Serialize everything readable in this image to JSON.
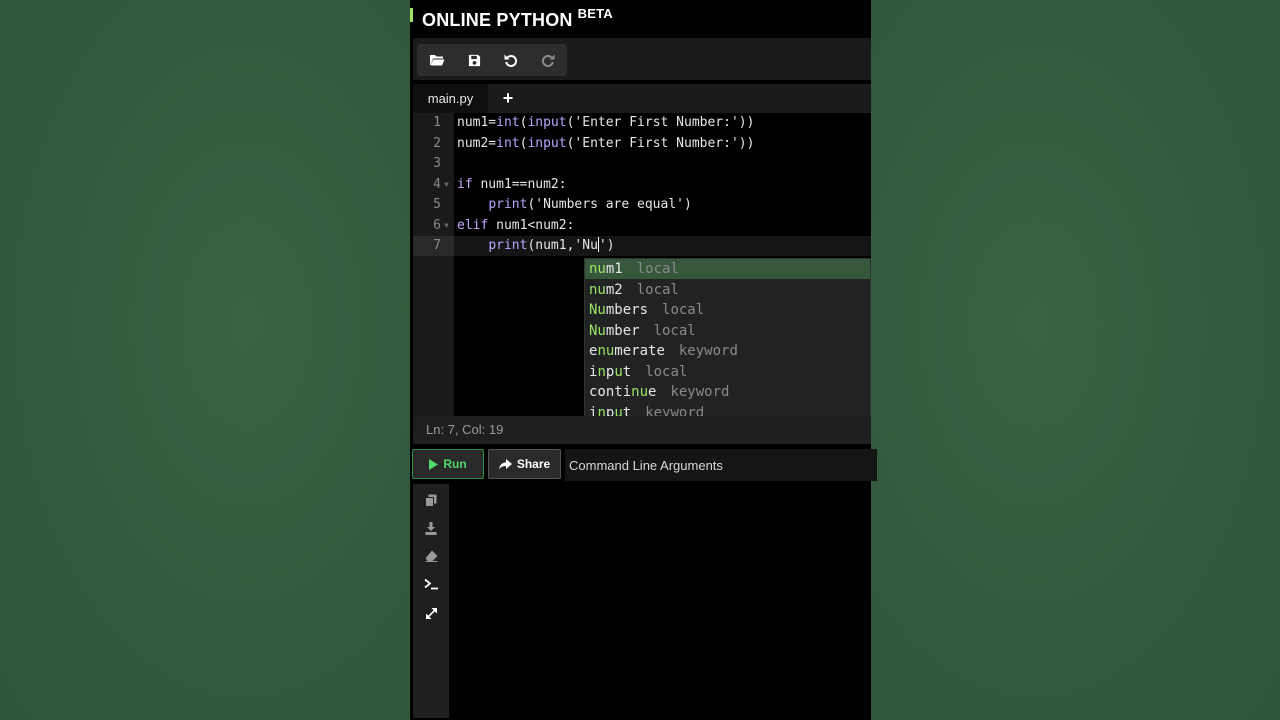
{
  "app": {
    "brand": "ONLINE PYTHON",
    "beta": "BETA"
  },
  "tabs": {
    "file": "main.py",
    "add": "+"
  },
  "editor": {
    "lines": [
      {
        "n": "1",
        "text": "num1=int(input('Enter First Number:'))"
      },
      {
        "n": "2",
        "text": "num2=int(input('Enter First Number:'))"
      },
      {
        "n": "3",
        "text": ""
      },
      {
        "n": "4",
        "text": "if num1==num2:"
      },
      {
        "n": "5",
        "text": "    print('Numbers are equal')"
      },
      {
        "n": "6",
        "text": "elif num1<num2:"
      },
      {
        "n": "7",
        "text": "    print(num1,'Nu')"
      }
    ]
  },
  "autocomplete": [
    {
      "label": "num1",
      "type": "local",
      "selected": true
    },
    {
      "label": "num2",
      "type": "local"
    },
    {
      "label": "Numbers",
      "type": "local"
    },
    {
      "label": "Number",
      "type": "local"
    },
    {
      "label": "enumerate",
      "type": "keyword"
    },
    {
      "label": "input",
      "type": "local"
    },
    {
      "label": "continue",
      "type": "keyword"
    },
    {
      "label": "input",
      "type": "keyword"
    }
  ],
  "status": {
    "position": "Ln: 7,  Col: 19"
  },
  "actions": {
    "run": "Run",
    "share": "Share",
    "args_placeholder": "Command Line Arguments"
  },
  "colors": {
    "accent": "#9be564",
    "run_text": "#4fd86a",
    "background": "#355b40"
  },
  "icons": {
    "toolbar": [
      "folder-open-icon",
      "save-icon",
      "undo-icon",
      "redo-icon"
    ],
    "console": [
      "copy-icon",
      "download-icon",
      "eraser-icon",
      "terminal-icon",
      "expand-icon"
    ]
  }
}
